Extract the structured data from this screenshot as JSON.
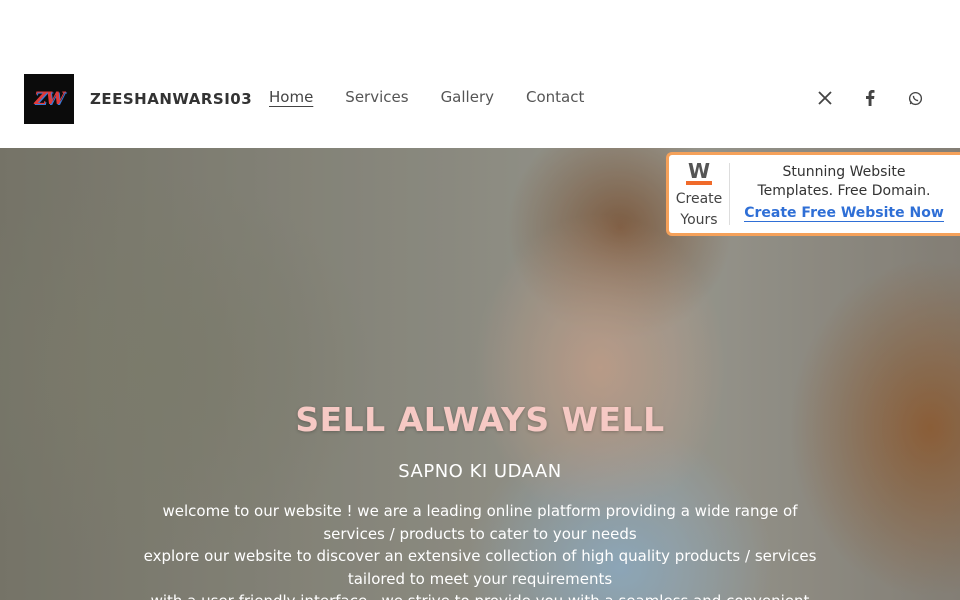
{
  "header": {
    "logo_text": "ZW",
    "brand": "ZEESHANWARSI03",
    "nav": [
      {
        "label": "Home",
        "active": true
      },
      {
        "label": "Services",
        "active": false
      },
      {
        "label": "Gallery",
        "active": false
      },
      {
        "label": "Contact",
        "active": false
      }
    ],
    "social": [
      "x-icon",
      "facebook-icon",
      "whatsapp-icon"
    ]
  },
  "ad": {
    "logo_letter": "W",
    "create_line1": "Create",
    "create_line2": "Yours",
    "text_line1": "Stunning Website",
    "text_line2": "Templates. Free Domain.",
    "link": "Create Free Website Now",
    "accent": "#f5a15a"
  },
  "hero": {
    "title": "SELL ALWAYS WELL",
    "subtitle": "SAPNO KI UDAAN",
    "body_lines": [
      "welcome to our website ! we are a leading online platform providing a wide range of services / products to cater to your needs",
      "explore our website to discover an extensive collection of high quality products / services tailored to meet your requirements",
      "with a user friendly interface , we strive to provide you with a seamless and convenient"
    ],
    "title_color": "#f6c9c4"
  }
}
